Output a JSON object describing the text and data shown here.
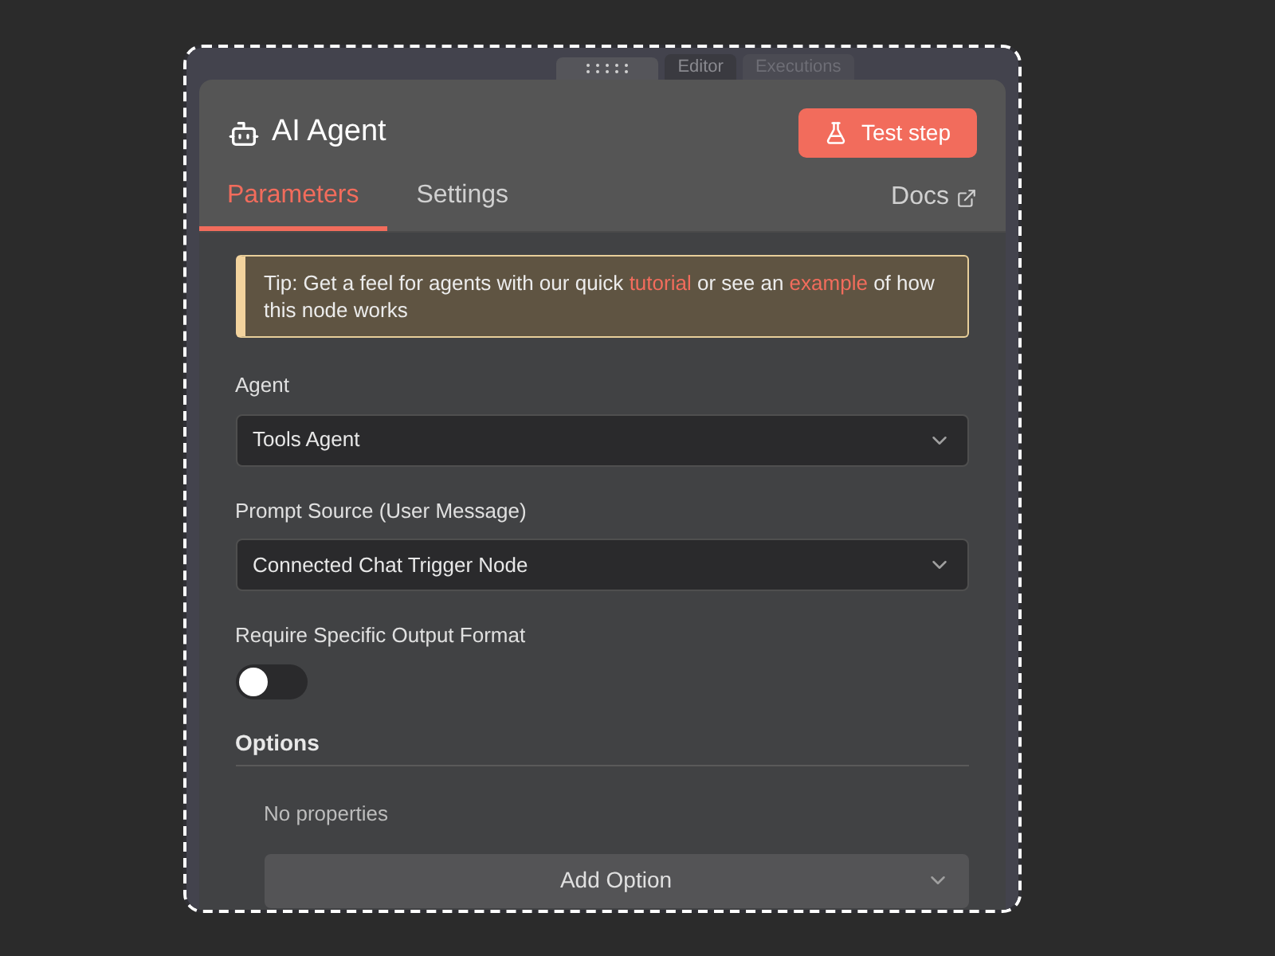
{
  "canvas_tabs": [
    {
      "label": "Editor",
      "selected": true
    },
    {
      "label": "Executions",
      "selected": false
    }
  ],
  "node": {
    "title": "AI Agent",
    "test_button": "Test step"
  },
  "tabs": [
    {
      "label": "Parameters",
      "selected": true
    },
    {
      "label": "Settings",
      "selected": false
    }
  ],
  "docs_link": "Docs",
  "tip": {
    "before": "Tip: Get a feel for agents with our quick",
    "link_1": "tutorial",
    "middle": "or see an",
    "link_2": "example",
    "after": "of how this node works"
  },
  "fields": [
    {
      "kind": "select",
      "label": "Agent",
      "value": "Tools Agent"
    },
    {
      "kind": "select",
      "label": "Prompt Source (User Message)",
      "value": "Connected Chat Trigger Node"
    },
    {
      "kind": "toggle",
      "label": "Require Specific Output Format",
      "on": false
    }
  ],
  "options": {
    "title": "Options",
    "empty_text": "No properties",
    "add_button": "Add Option"
  }
}
